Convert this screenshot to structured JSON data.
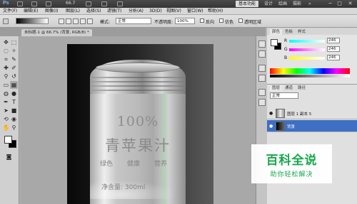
{
  "app": {
    "logo": "Ps",
    "zoom": "66.7"
  },
  "workspace": {
    "buttons": [
      "基本功能",
      "设计",
      "绘画",
      "摄影"
    ],
    "expand": "»"
  },
  "window_controls": [
    "─",
    "□",
    "✕"
  ],
  "menu": [
    "文件(F)",
    "编辑(E)",
    "图像(I)",
    "图层(L)",
    "选择(S)",
    "滤镜(T)",
    "分析(A)",
    "3D(D)",
    "视图(V)",
    "窗口(W)",
    "帮助(H)"
  ],
  "options": {
    "mode_label": "模式:",
    "mode_value": "正常",
    "opacity_label": "不透明度:",
    "opacity_value": "100%",
    "reverse": "反向",
    "dither": "仿色",
    "transparency": "透明区域"
  },
  "document_tab": "未标题-1 @ 66.7% (背景, RGB/8) *",
  "can_label": {
    "percent": "100%",
    "name": "青苹果汁",
    "tags": [
      "绿色",
      "健康",
      "营养"
    ],
    "net": "净含量: 300ml"
  },
  "color_panel": {
    "tabs": [
      "颜色",
      "色板",
      "样式"
    ],
    "channels": [
      {
        "label": "R",
        "value": "246"
      },
      {
        "label": "G",
        "value": "246"
      },
      {
        "label": "B",
        "value": "246"
      }
    ]
  },
  "layers_panel": {
    "tabs": [
      "图层",
      "通道",
      "路径"
    ],
    "blend_mode": "正常",
    "layers": [
      {
        "name": "图层 1 副本 5"
      },
      {
        "name": "背景"
      }
    ]
  },
  "watermark": {
    "title": "百科全说",
    "subtitle": "助你轻松解决"
  }
}
